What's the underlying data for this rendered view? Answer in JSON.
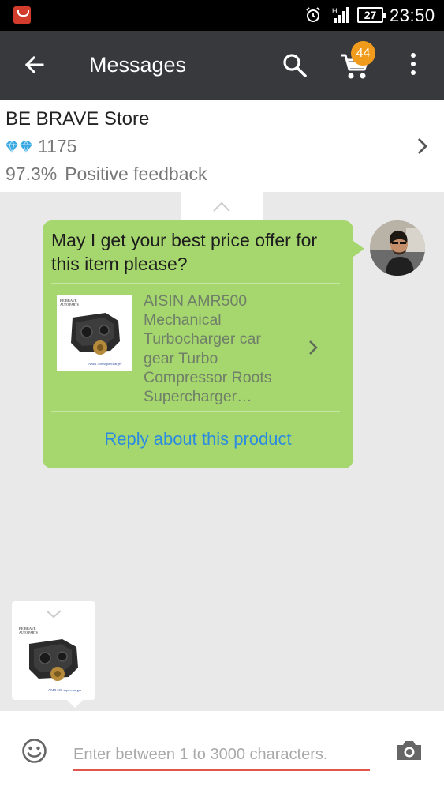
{
  "status_bar": {
    "battery": "27",
    "time": "23:50",
    "icons": [
      "aliexpress-notification-icon",
      "alarm-icon",
      "signal-icon",
      "battery-icon"
    ]
  },
  "app_bar": {
    "title": "Messages",
    "cart_count": "44",
    "icons": [
      "back-arrow-icon",
      "search-icon",
      "cart-icon",
      "more-vert-icon"
    ]
  },
  "store": {
    "name": "BE BRAVE Store",
    "score": "1175",
    "feedback_percent": "97.3%",
    "feedback_label": "Positive feedback",
    "icons": [
      "diamond-icon",
      "chevron-right-icon"
    ]
  },
  "message": {
    "text": "May I get your best price offer for this item please?",
    "product_title": "AISIN AMR500 Mechanical Turbocharger car gear Turbo Compressor Roots Supercharger…",
    "reply_label": "Reply about this product",
    "bubble_color": "#a6d66e",
    "link_color": "#2b8be0"
  },
  "product_image": {
    "store_caption_1": "BE BRAVE",
    "store_caption_2": "AUTO PARTS",
    "caption": "AMR 500 supercharger"
  },
  "input": {
    "placeholder": "Enter between 1 to 3000 characters.",
    "value": "",
    "icons": [
      "emoji-icon",
      "camera-icon"
    ],
    "underline_color": "#e0564c"
  }
}
